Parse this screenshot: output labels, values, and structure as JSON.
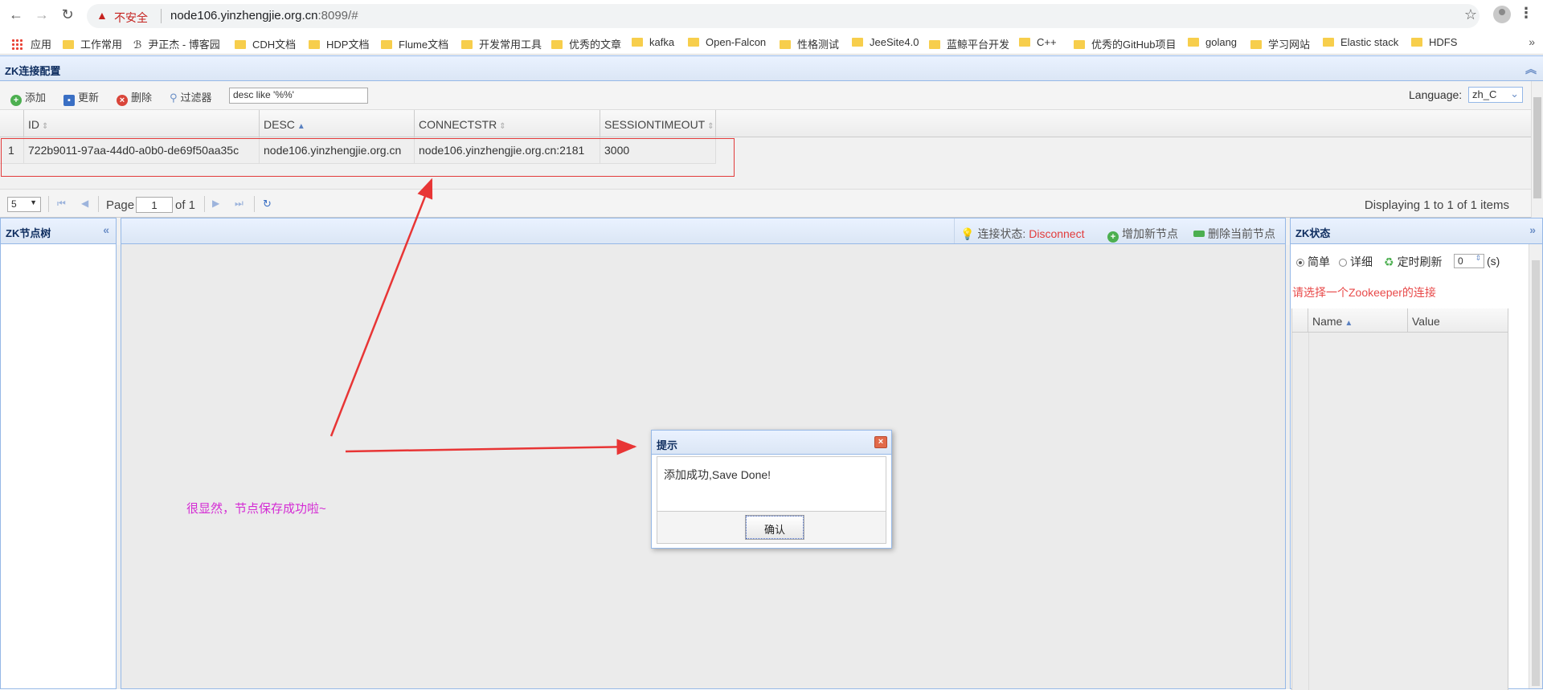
{
  "browser": {
    "insecure_label": "不安全",
    "host": "node106.yinzhengjie.org.cn",
    "port_path": ":8099/#"
  },
  "bookmarks": [
    "应用",
    "工作常用",
    "尹正杰 - 博客园",
    "CDH文档",
    "HDP文档",
    "Flume文档",
    "开发常用工具",
    "优秀的文章",
    "kafka",
    "Open-Falcon",
    "性格测试",
    "JeeSite4.0",
    "蓝鲸平台开发",
    "C++",
    "优秀的GitHub项目",
    "golang",
    "学习网站",
    "Elastic stack",
    "HDFS"
  ],
  "config_panel": {
    "title": "ZK连接配置",
    "toolbar": {
      "add_label": "添加",
      "update_label": "更新",
      "delete_label": "删除",
      "filter_label": "过滤器",
      "filter_value": "desc like '%%'",
      "language_label": "Language:",
      "language_value": "zh_C"
    },
    "columns": [
      "ID",
      "DESC",
      "CONNECTSTR",
      "SESSIONTIMEOUT"
    ],
    "rows": [
      {
        "num": "1",
        "id": "722b9011-97aa-44d0-a0b0-de69f50aa35c",
        "desc": "node106.yinzhengjie.org.cn",
        "connectstr": "node106.yinzhengjie.org.cn:2181",
        "sessiontimeout": "3000"
      }
    ],
    "pager": {
      "page_size": "5",
      "page_label": "Page",
      "page_value": "1",
      "of_label": "of 1",
      "displaying": "Displaying 1 to 1 of 1 items"
    }
  },
  "tree_panel": {
    "title": "ZK节点树"
  },
  "center_panel": {
    "conn_status_label": "连接状态:",
    "conn_status_value": "Disconnect",
    "add_node_label": "增加新节点",
    "delete_node_label": "删除当前节点"
  },
  "status_panel": {
    "title": "ZK状态",
    "simple_label": "简单",
    "detail_label": "详细",
    "refresh_label": "定时刷新",
    "refresh_value": "0",
    "refresh_unit": "(s)",
    "message": "请选择一个Zookeeper的连接",
    "columns": [
      "Name",
      "Value"
    ]
  },
  "annotation": {
    "text": "很显然，节点保存成功啦~"
  },
  "dialog": {
    "title": "提示",
    "message": "添加成功,Save Done!",
    "ok_label": "确认"
  },
  "colors": {
    "panel_border": "#95b8e7",
    "highlight_red": "#e23b3b",
    "annotation_magenta": "#d42bd4"
  }
}
